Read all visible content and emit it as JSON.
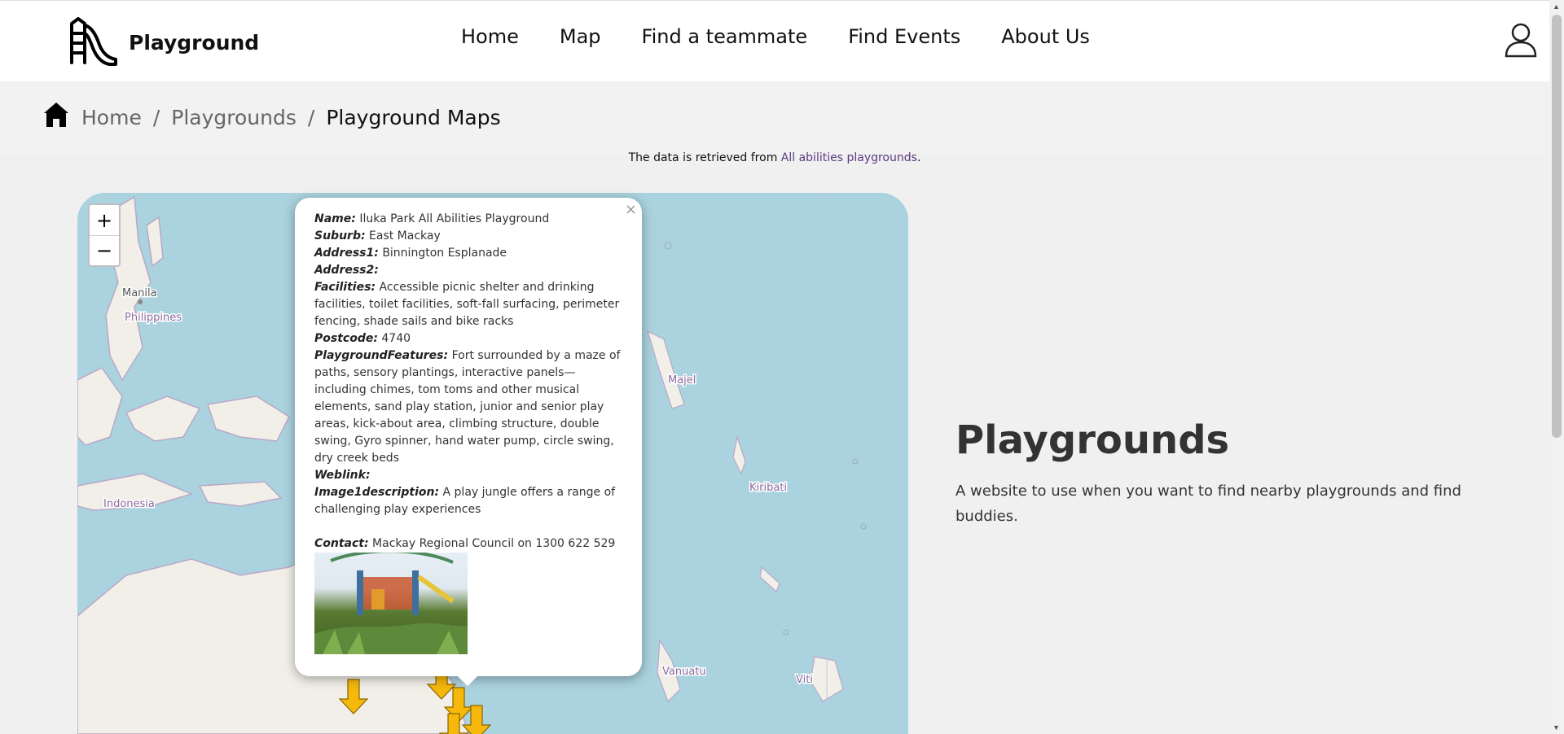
{
  "header": {
    "brand": "Playground",
    "nav": [
      "Home",
      "Map",
      "Find a teammate",
      "Find Events",
      "About Us"
    ]
  },
  "breadcrumb": {
    "items": [
      "Home",
      "Playgrounds"
    ],
    "current": "Playground Maps"
  },
  "source": {
    "prefix": "The data is retrieved from ",
    "link": "All abilities playgrounds",
    "suffix": "."
  },
  "map": {
    "zoom_in": "+",
    "zoom_out": "−",
    "labels": [
      "Manila",
      "Philippines",
      "Indonesia",
      "Majel",
      "Kiribati",
      "Vanuatu",
      "Viti"
    ],
    "popup": {
      "close": "×",
      "name_label": "Name:",
      "name": "Iluka Park All Abilities Playground",
      "suburb_label": "Suburb:",
      "suburb": "East Mackay",
      "address1_label": "Address1:",
      "address1": "Binnington Esplanade",
      "address2_label": "Address2:",
      "address2": "",
      "facilities_label": "Facilities:",
      "facilities": "Accessible picnic shelter and drinking facilities, toilet facilities, soft-fall surfacing, perimeter fencing, shade sails and bike racks",
      "postcode_label": "Postcode:",
      "postcode": "4740",
      "features_label": "PlaygroundFeatures:",
      "features": "Fort surrounded by a maze of paths, sensory plantings, interactive panels—including chimes, tom toms and other musical elements, sand play station, junior and senior play areas, kick-about area, climbing structure, double swing, Gyro spinner, hand water pump, circle swing, dry creek beds",
      "weblink_label": "Weblink:",
      "weblink": "",
      "imagedesc_label": "Image1description:",
      "imagedesc": "A play jungle offers a range of challenging play experiences",
      "contact_label": "Contact:",
      "contact": "Mackay Regional Council on 1300 622 529"
    }
  },
  "hero": {
    "title": "Playgrounds",
    "subtitle": "A website to use when you want to find nearby playgrounds and find buddies."
  },
  "colors": {
    "link": "#5b3a80",
    "water": "#aad3df",
    "land": "#f2efe9",
    "marker": "#f5b80b"
  }
}
